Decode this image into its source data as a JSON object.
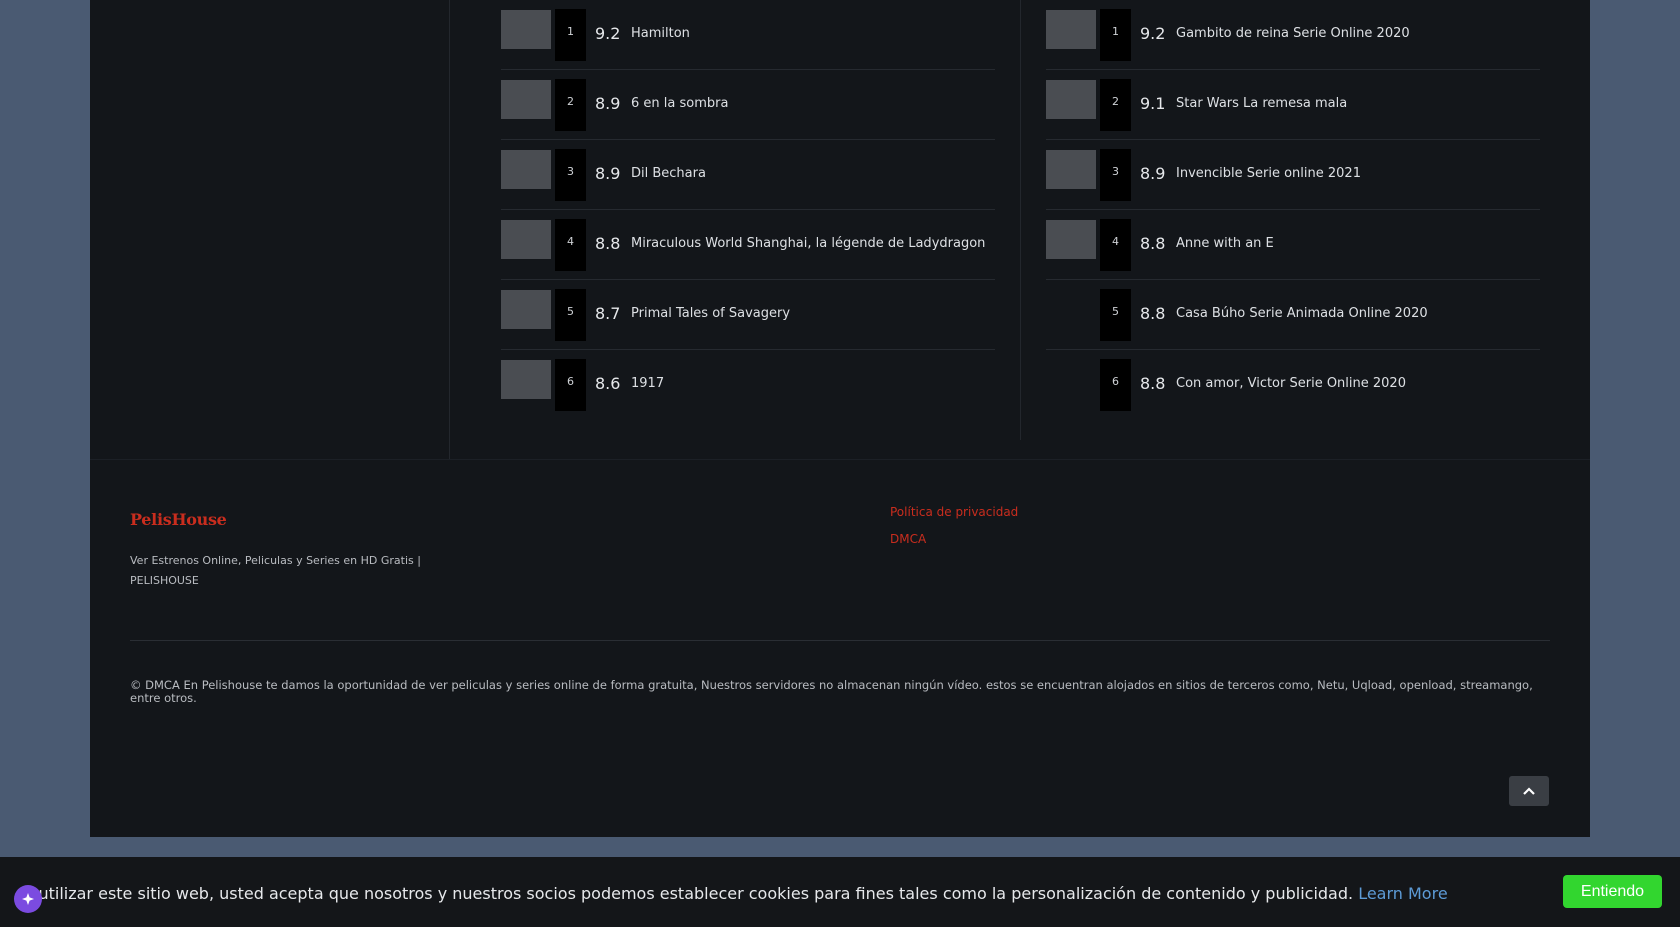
{
  "rankings_left": [
    {
      "rank": "1",
      "score": "9.2",
      "title": "Hamilton",
      "thumb": true
    },
    {
      "rank": "2",
      "score": "8.9",
      "title": "6 en la sombra",
      "thumb": true
    },
    {
      "rank": "3",
      "score": "8.9",
      "title": "Dil Bechara",
      "thumb": true
    },
    {
      "rank": "4",
      "score": "8.8",
      "title": "Miraculous World Shanghai, la légende de Ladydragon",
      "thumb": true
    },
    {
      "rank": "5",
      "score": "8.7",
      "title": "Primal Tales of Savagery",
      "thumb": true
    },
    {
      "rank": "6",
      "score": "8.6",
      "title": "1917",
      "thumb": true
    }
  ],
  "rankings_right": [
    {
      "rank": "1",
      "score": "9.2",
      "title": "Gambito de reina Serie Online 2020",
      "thumb": true
    },
    {
      "rank": "2",
      "score": "9.1",
      "title": "Star Wars La remesa mala",
      "thumb": true
    },
    {
      "rank": "3",
      "score": "8.9",
      "title": "Invencible Serie online 2021",
      "thumb": true
    },
    {
      "rank": "4",
      "score": "8.8",
      "title": "Anne with an E",
      "thumb": true
    },
    {
      "rank": "5",
      "score": "8.8",
      "title": "Casa Búho Serie Animada Online 2020",
      "thumb": false
    },
    {
      "rank": "6",
      "score": "8.8",
      "title": "Con amor, Victor Serie Online 2020",
      "thumb": false
    }
  ],
  "footer": {
    "logo": "PelisHouse",
    "tagline": "Ver Estrenos Online, Peliculas y Series en HD Gratis | PELISHOUSE",
    "links": [
      "Política de privacidad",
      "DMCA"
    ],
    "copyright": "© DMCA En Pelishouse te damos la oportunidad de ver peliculas y series online de forma gratuita, Nuestros servidores no almacenan ningún vídeo. estos se encuentran alojados en sitios de terceros como, Netu, Uqload, openload, streamango, entre otros.",
    "totop_icon": "chevron-up-icon"
  },
  "cookie": {
    "text": "Al utilizar este sitio web, usted acepta que nosotros y nuestros socios podemos establecer cookies para fines tales como la personalización de contenido y publicidad.",
    "learn_more": "Learn More",
    "accept": "Entiendo"
  },
  "colors": {
    "background": "#4a5a72",
    "panel": "#13161a",
    "accent": "#c92d1e",
    "accept_button": "#32d62f",
    "link": "#5d9bd6"
  }
}
